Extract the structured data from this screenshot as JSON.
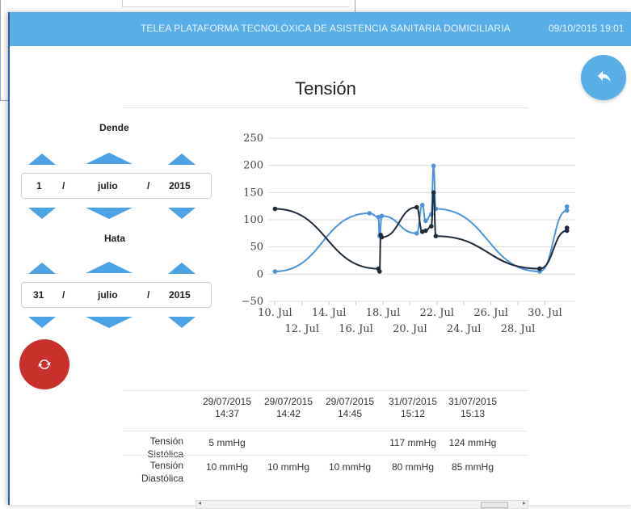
{
  "header": {
    "title": "TELEA PLATAFORMA TECNOLÓXICA DE ASISTENCIA SANITARIA DOMICILIARIA",
    "datetime": "09/10/2015 19:01"
  },
  "page_title": "Tensión",
  "from": {
    "label": "Dende",
    "day": "1",
    "month": "julio",
    "year": "2015",
    "sep": "/"
  },
  "to": {
    "label": "Hata",
    "day": "31",
    "month": "julio",
    "year": "2015",
    "sep": "/"
  },
  "icons": {
    "back": "reply-arrow-icon",
    "refresh": "refresh-icon"
  },
  "colors": {
    "header": "#5aaee8",
    "accent": "#4ba3e6",
    "refresh": "#c9302c",
    "systolic": "#4b94d9",
    "diastolic": "#1d2b3a"
  },
  "chart_data": {
    "type": "line",
    "x_axis_type": "datetime",
    "ylim": [
      -50,
      250
    ],
    "yticks": [
      "250",
      "200",
      "150",
      "100",
      "50",
      "0",
      "−50"
    ],
    "xticks": [
      "10. Jul",
      "12. Jul",
      "14. Jul",
      "16. Jul",
      "18. Jul",
      "20. Jul",
      "22. Jul",
      "24. Jul",
      "26. Jul",
      "28. Jul",
      "30. Jul"
    ],
    "grid": true,
    "series": [
      {
        "color": "#4b94d9",
        "points": [
          {
            "x": "2015-07-10",
            "y": 5
          },
          {
            "x": "2015-07-17",
            "y": 112
          },
          {
            "x": "2015-07-17 16:00",
            "y": 105
          },
          {
            "x": "2015-07-17 18:00",
            "y": 70
          },
          {
            "x": "2015-07-17 22:00",
            "y": 107
          },
          {
            "x": "2015-07-20 12:00",
            "y": 75
          },
          {
            "x": "2015-07-20 22:00",
            "y": 127
          },
          {
            "x": "2015-07-21 04:00",
            "y": 98
          },
          {
            "x": "2015-07-21 14:00",
            "y": 110
          },
          {
            "x": "2015-07-21 18:00",
            "y": 199
          },
          {
            "x": "2015-07-21 22:00",
            "y": 120
          },
          {
            "x": "2015-07-29 14:37",
            "y": 5
          },
          {
            "x": "2015-07-31 15:12",
            "y": 117
          },
          {
            "x": "2015-07-31 15:13",
            "y": 124
          }
        ]
      },
      {
        "color": "#1d2b3a",
        "points": [
          {
            "x": "2015-07-10",
            "y": 120
          },
          {
            "x": "2015-07-17 16:00",
            "y": 10
          },
          {
            "x": "2015-07-17 18:00",
            "y": 5
          },
          {
            "x": "2015-07-17 20:00",
            "y": 72
          },
          {
            "x": "2015-07-17 22:00",
            "y": 68
          },
          {
            "x": "2015-07-20 12:00",
            "y": 123
          },
          {
            "x": "2015-07-20 22:00",
            "y": 78
          },
          {
            "x": "2015-07-21 04:00",
            "y": 80
          },
          {
            "x": "2015-07-21 14:00",
            "y": 88
          },
          {
            "x": "2015-07-21 18:00",
            "y": 150
          },
          {
            "x": "2015-07-21 22:00",
            "y": 70
          },
          {
            "x": "2015-07-29 14:37",
            "y": 10
          },
          {
            "x": "2015-07-29 14:42",
            "y": 10
          },
          {
            "x": "2015-07-29 14:45",
            "y": 10
          },
          {
            "x": "2015-07-31 15:12",
            "y": 80
          },
          {
            "x": "2015-07-31 15:13",
            "y": 85
          }
        ]
      }
    ]
  },
  "table": {
    "columns": [
      {
        "date": "29/07/2015",
        "time": "14:37"
      },
      {
        "date": "29/07/2015",
        "time": "14:42"
      },
      {
        "date": "29/07/2015",
        "time": "14:45"
      },
      {
        "date": "31/07/2015",
        "time": "15:12"
      },
      {
        "date": "31/07/2015",
        "time": "15:13"
      }
    ],
    "rows": [
      {
        "label1": "Tensión",
        "label2": "Sistólica",
        "values": [
          "5 mmHg",
          "",
          "",
          "117 mmHg",
          "124 mmHg"
        ]
      },
      {
        "label1": "Tensión",
        "label2": "Diastólica",
        "values": [
          "10 mmHg",
          "10 mmHg",
          "10 mmHg",
          "80 mmHg",
          "85 mmHg"
        ]
      }
    ]
  }
}
